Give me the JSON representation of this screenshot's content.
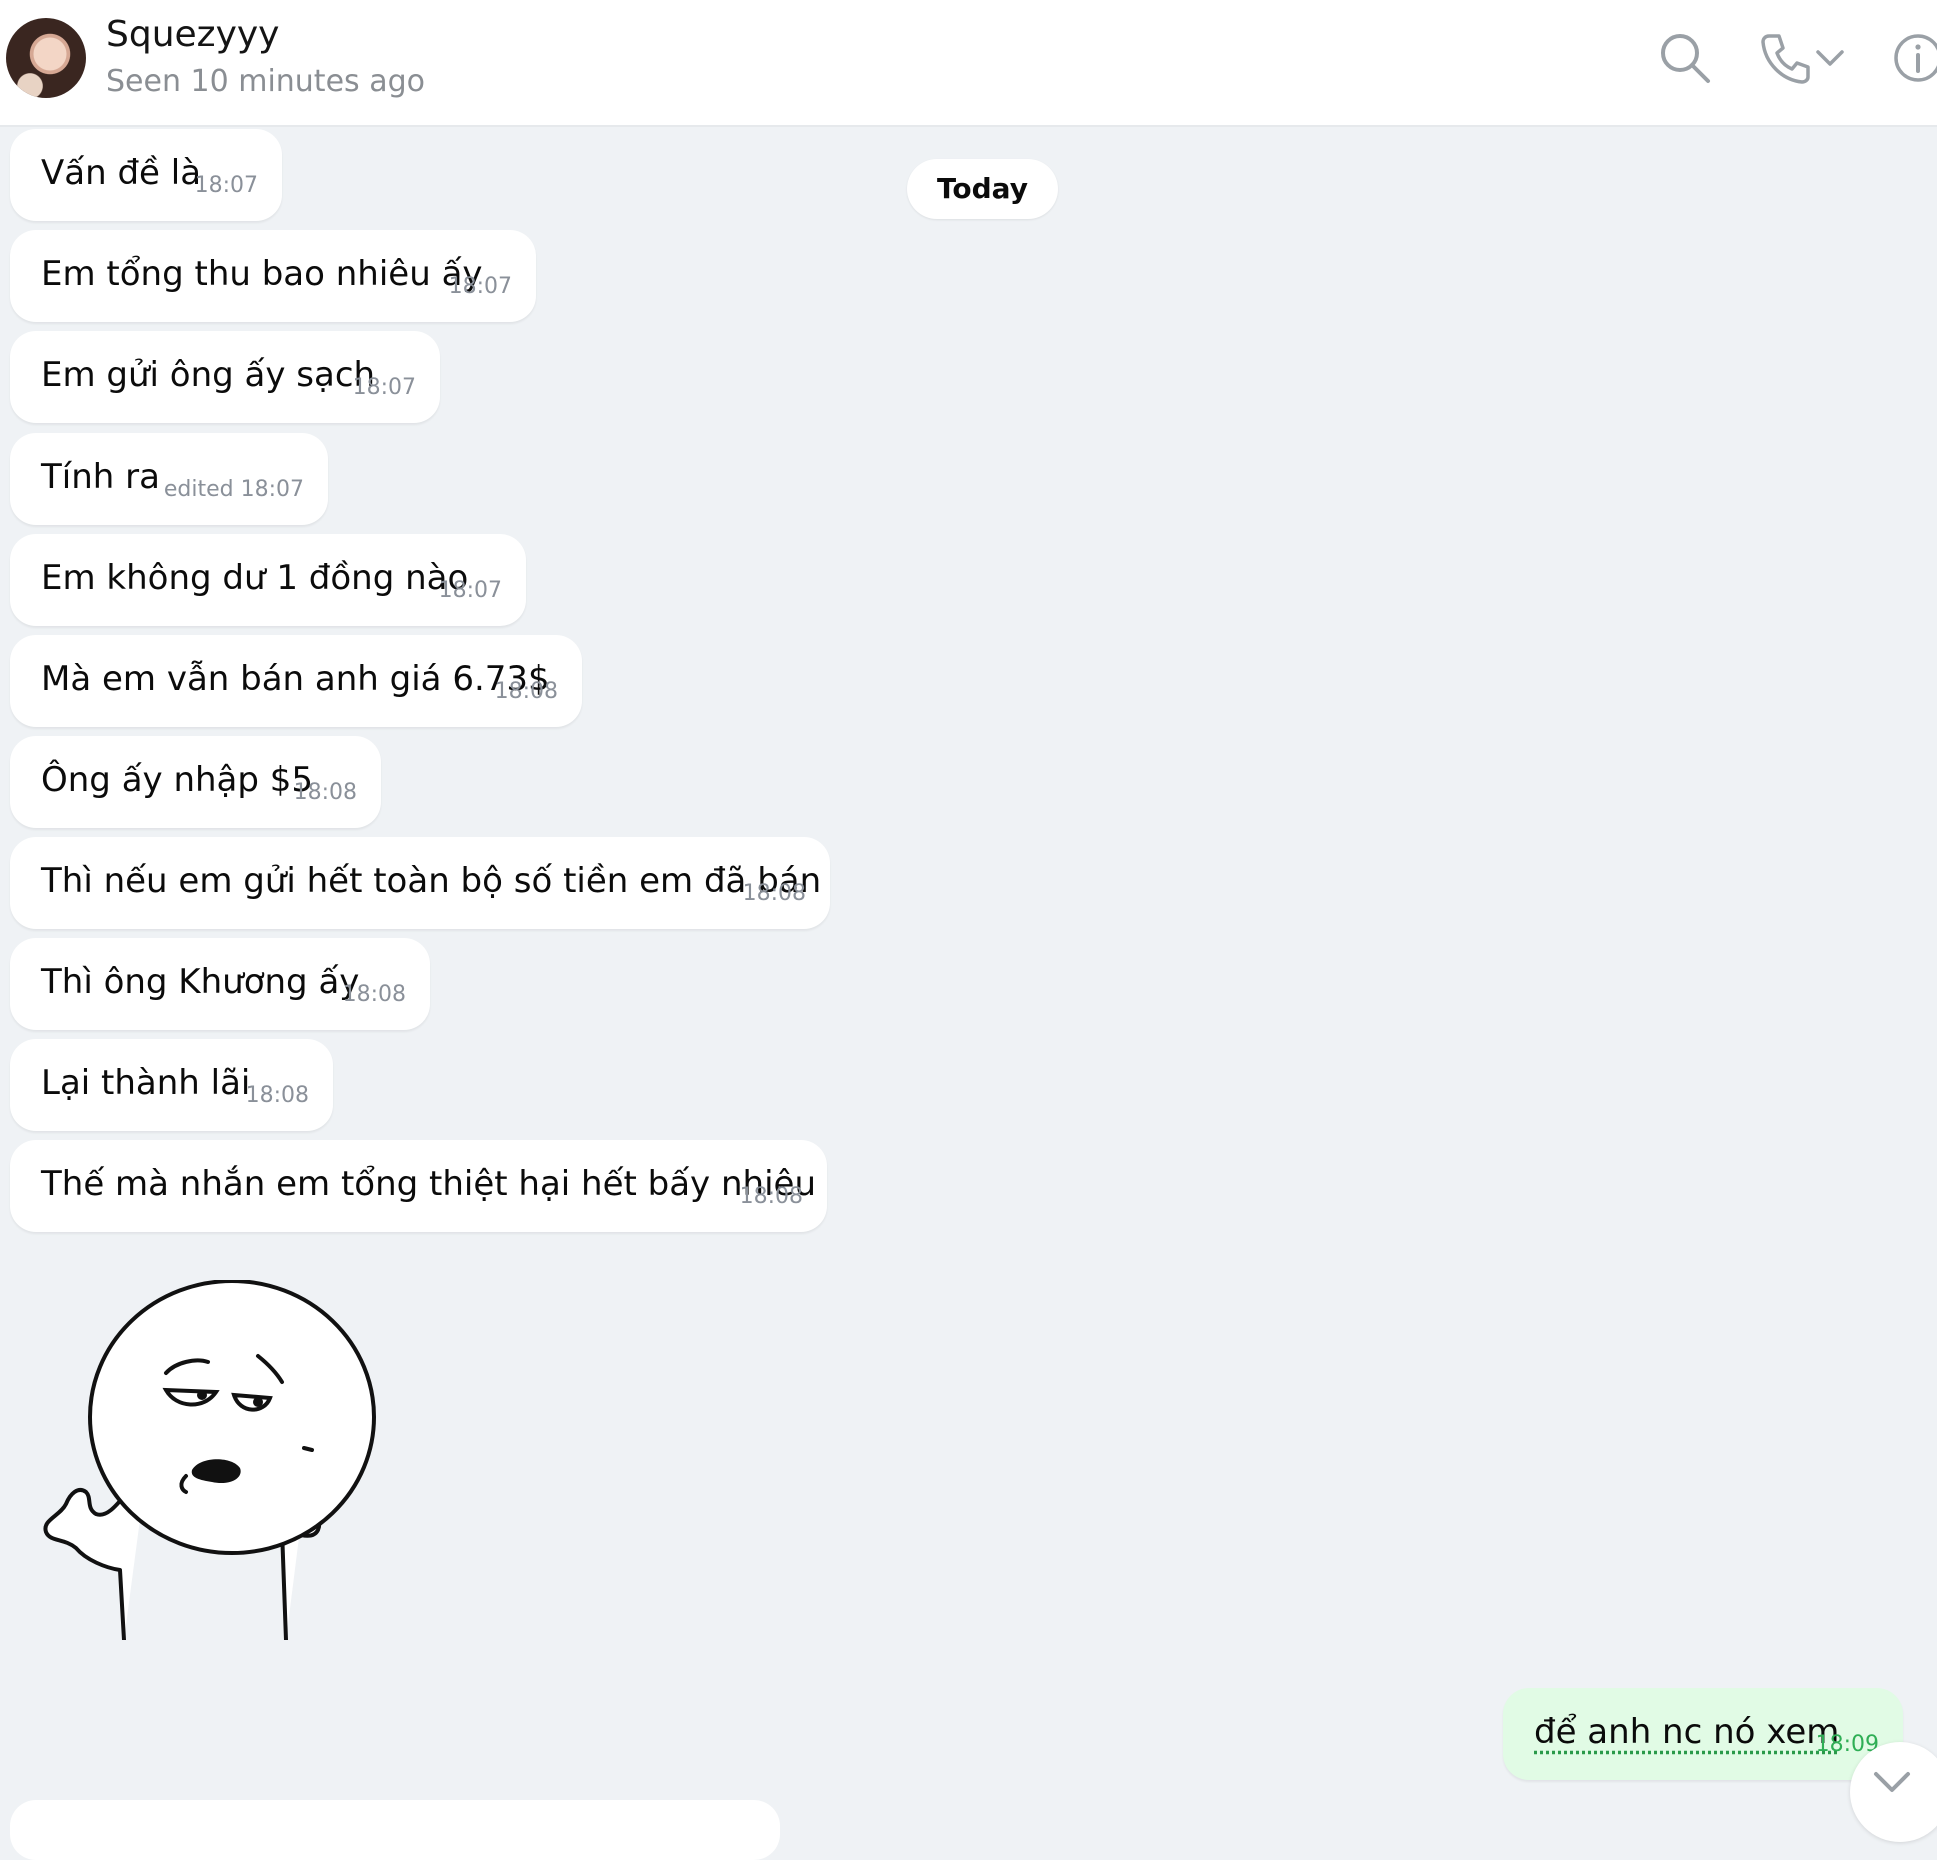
{
  "header": {
    "contact_name": "Squezyyy",
    "status": "Seen 10 minutes ago",
    "icons": [
      "search-icon",
      "phone-icon",
      "chevron-down-icon",
      "info-icon"
    ]
  },
  "day_separator": "Today",
  "messages": [
    {
      "text": "Vấn đề là",
      "time": "18:07"
    },
    {
      "text": "Em tổng thu bao nhiêu ấy",
      "time": "18:07"
    },
    {
      "text": "Em gửi ông ấy sạch",
      "time": "18:07"
    },
    {
      "text": "Tính ra",
      "time": "edited 18:07"
    },
    {
      "text": "Em không dư 1 đồng nào",
      "time": "18:07"
    },
    {
      "text": "Mà em vẫn bán anh giá 6.73$",
      "time": "18:08"
    },
    {
      "text": "Ông ấy nhập $5",
      "time": "18:08"
    },
    {
      "text": "Thì nếu em gửi hết toàn bộ số tiền em đã bán",
      "time": "18:08"
    },
    {
      "text": "Thì ông Khương ấy",
      "time": "18:08"
    },
    {
      "text": "Lại thành lãi",
      "time": "18:08"
    },
    {
      "text": "Thế mà nhắn em tổng thiệt hại hết bấy nhiêu",
      "time": "18:08"
    }
  ],
  "outgoing": {
    "text": "để anh nc nó xem",
    "time": "18:09"
  },
  "colors": {
    "background": "#eff2f5",
    "incoming_bubble": "#ffffff",
    "outgoing_bubble": "#e1fbe5",
    "outgoing_time": "#2fae55",
    "muted_text": "#8a9099"
  }
}
